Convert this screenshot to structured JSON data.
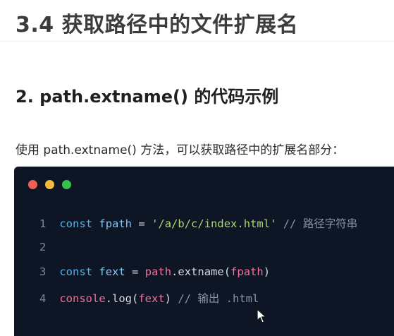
{
  "slide": {
    "title": "3.4 获取路径中的文件扩展名",
    "section_heading": "2. path.extname() 的代码示例",
    "intro": "使用 path.extname() 方法，可以获取路径中的扩展名部分："
  },
  "code": {
    "window_dots": [
      "#ef5f55",
      "#f5b83a",
      "#35c24a"
    ],
    "lines": [
      {
        "number": "1",
        "tokens": {
          "keyword": "const",
          "name": "fpath",
          "operator": "=",
          "string": "'/a/b/c/index.html'",
          "comment": "// 路径字符串"
        }
      },
      {
        "number": "2"
      },
      {
        "number": "3",
        "tokens": {
          "keyword": "const",
          "name": "fext",
          "operator": "=",
          "object": "path",
          "method": ".extname(",
          "arg": "fpath",
          "close": ")"
        }
      },
      {
        "number": "4",
        "tokens": {
          "object": "console",
          "method": ".log(",
          "arg": "fext",
          "close": ")",
          "comment": "// 输出 .html"
        }
      }
    ]
  },
  "icons": {
    "cursor": "mouse-pointer-icon"
  }
}
